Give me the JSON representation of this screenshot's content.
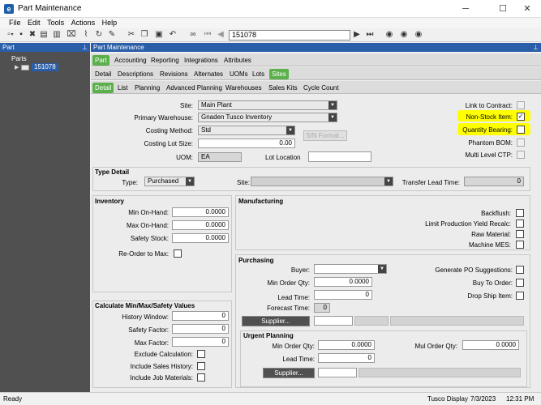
{
  "window": {
    "title": "Part Maintenance",
    "app_icon_letter": "e",
    "minimize": "─",
    "maximize": "☐",
    "close": "✕"
  },
  "menu": [
    "File",
    "Edit",
    "Tools",
    "Actions",
    "Help"
  ],
  "toolbar": {
    "part_key": "151078",
    "icons": [
      "new-icon",
      "save-icon",
      "delete-icon",
      "print-icon",
      "library-icon",
      "attachment-icon",
      "refresh-icon",
      "clear-icon",
      "cut-icon",
      "copy-icon",
      "paste-icon",
      "undo-icon",
      "search-binoculars-icon",
      "first-record-icon",
      "previous-record-icon",
      "next-record-icon",
      "last-record-icon",
      "back-icon",
      "forward-icon",
      "stop-icon"
    ]
  },
  "left_pane": {
    "header": "Part",
    "pin": "📌",
    "tree_root": "Parts",
    "tree_node": "151078"
  },
  "right_pane": {
    "header": "Part Maintenance",
    "pin": "📌"
  },
  "tabs": {
    "row1": [
      "Part",
      "Accounting",
      "Reporting",
      "Integrations",
      "Attributes"
    ],
    "row2": [
      "Detail",
      "Descriptions",
      "Revisions",
      "Alternates",
      "UOMs",
      "Lots",
      "Sites"
    ],
    "row3": [
      "Detail",
      "List",
      "Planning",
      "Advanced Planning",
      "Warehouses",
      "Sales Kits",
      "Cycle Count"
    ]
  },
  "site_detail": {
    "site_label": "Site:",
    "site_value": "Main Plant",
    "primary_wh_label": "Primary Warehouse:",
    "primary_wh_value": "Gnaden Tusco Inventory",
    "costing_method_label": "Costing Method:",
    "costing_method_value": "Std",
    "sn_format_button": "S/N Format...",
    "costing_lot_label": "Costing Lot Size:",
    "costing_lot_value": "0.00",
    "uom_label": "UOM:",
    "uom_value": "EA",
    "lot_location_label": "Lot Location",
    "lot_location_value": "",
    "link_to_contract_label": "Link to Contract:",
    "non_stock_label": "Non-Stock Item:",
    "non_stock_checked": "✓",
    "qty_bearing_label": "Quantity Bearing:",
    "phantom_bom_label": "Phantom BOM:",
    "multi_level_ctp_label": "Multi Level CTP:"
  },
  "type_detail": {
    "title": "Type Detail",
    "type_label": "Type:",
    "type_value": "Purchased",
    "site_label": "Site:",
    "site_value": "",
    "transfer_lead_label": "Transfer Lead Time:",
    "transfer_lead_value": "0"
  },
  "inventory": {
    "title": "Inventory",
    "min_label": "Min On-Hand:",
    "min_value": "0.0000",
    "max_label": "Max On-Hand:",
    "max_value": "0.0000",
    "safety_label": "Safety Stock:",
    "safety_value": "0.0000",
    "reorder_label": "Re-Order to Max:"
  },
  "manufacturing": {
    "title": "Manufacturing",
    "backflush_label": "Backflush:",
    "limit_label": "Limit Production Yield Recalc:",
    "raw_label": "Raw Material:",
    "machine_label": "Machine MES:"
  },
  "purchasing": {
    "title": "Purchasing",
    "buyer_label": "Buyer:",
    "buyer_value": "",
    "min_order_label": "Min Order Qty:",
    "min_order_value": "0.0000",
    "lead_time_label": "Lead Time:",
    "lead_time_value": "0",
    "forecast_label": "Forecast Time:",
    "forecast_value": "0",
    "supplier_button": "Supplier...",
    "gen_po_label": "Generate PO Suggestions:",
    "buy_to_order_label": "Buy To Order:",
    "drop_ship_label": "Drop Ship Item:"
  },
  "urgent": {
    "title": "Urgent Planning",
    "min_order_label": "Min Order Qty:",
    "min_order_value": "0.0000",
    "mul_order_label": "Mul Order Qty:",
    "mul_order_value": "0.0000",
    "lead_time_label": "Lead Time:",
    "lead_time_value": "0",
    "supplier_button": "Supplier..."
  },
  "calc": {
    "title": "Calculate Min/Max/Safety Values",
    "history_label": "History Window:",
    "history_value": "0",
    "safety_factor_label": "Safety Factor:",
    "safety_factor_value": "0",
    "max_factor_label": "Max Factor:",
    "max_factor_value": "0",
    "exclude_label": "Exclude Calculation:",
    "include_sales_label": "Include Sales History:",
    "include_job_label": "Include Job Materials:"
  },
  "status": {
    "left": "Ready",
    "company": "Tusco Display",
    "date": "7/3/2023",
    "time": "12:31 PM"
  },
  "colors": {
    "accent_blue": "#2a5ea8",
    "tab_green": "#5bb04b",
    "highlight": "#ffff00"
  }
}
